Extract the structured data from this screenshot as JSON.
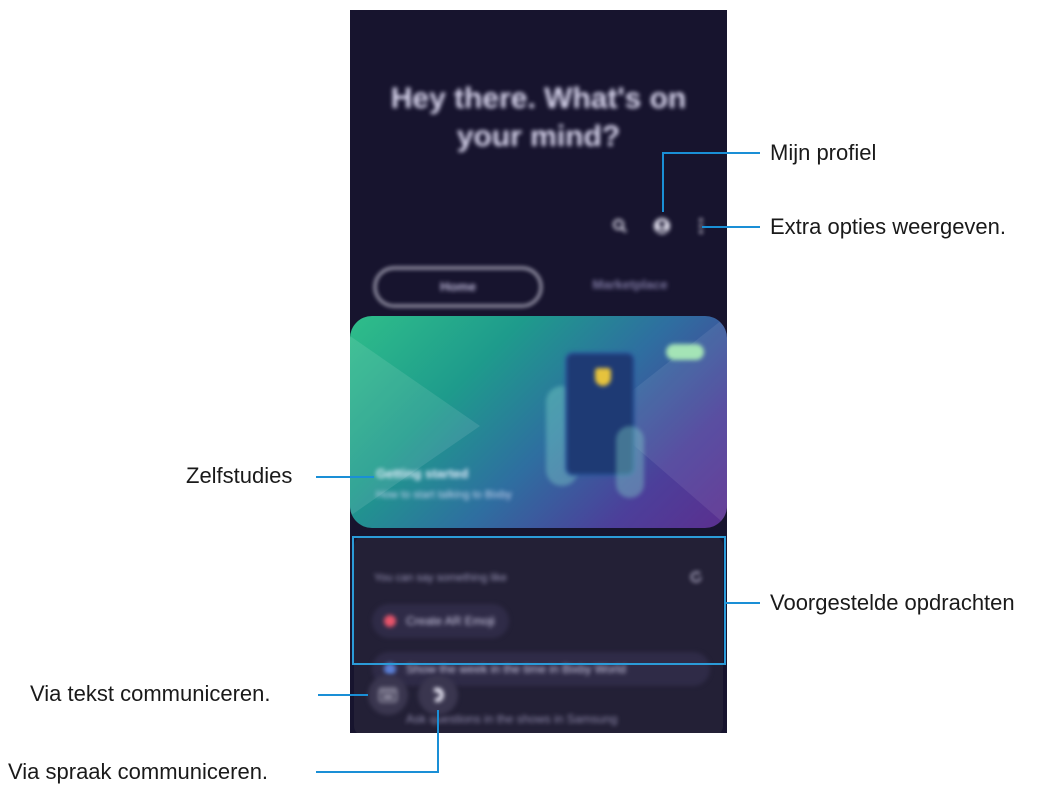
{
  "screen": {
    "greeting": "Hey there. What's on your mind?",
    "icons": [
      "search-icon",
      "profile-icon",
      "more-options-icon"
    ],
    "tabs": [
      {
        "label": "Home",
        "active": true
      },
      {
        "label": "Marketplace",
        "active": false
      }
    ],
    "tutorial_card": {
      "title": "Getting started",
      "subtitle": "How to start talking to Bixby"
    },
    "suggestions": {
      "label": "You can say something like",
      "refresh_icon": "refresh-icon",
      "chips": [
        {
          "label": "Create AR Emoji",
          "dot_color": "#e8546a"
        },
        {
          "label": "Show the week in the time in Bixby World",
          "dot_color": "#5a7fd6"
        },
        {
          "label": "Ask questions in the shows in Samsung",
          "dot_color": "#5a7fd6"
        }
      ]
    },
    "bottom_buttons": [
      "keyboard-icon",
      "voice-icon"
    ]
  },
  "callouts": {
    "profile": "Mijn profiel",
    "more_options": "Extra opties weergeven.",
    "tutorials": "Zelfstudies",
    "suggested_commands": "Voorgestelde opdrachten",
    "text": "Via tekst communiceren.",
    "voice": "Via spraak communiceren."
  },
  "colors": {
    "screen_bg": "#17142e",
    "callout_line": "#1a8fd6",
    "highlight_box": "#2b9bd8"
  }
}
